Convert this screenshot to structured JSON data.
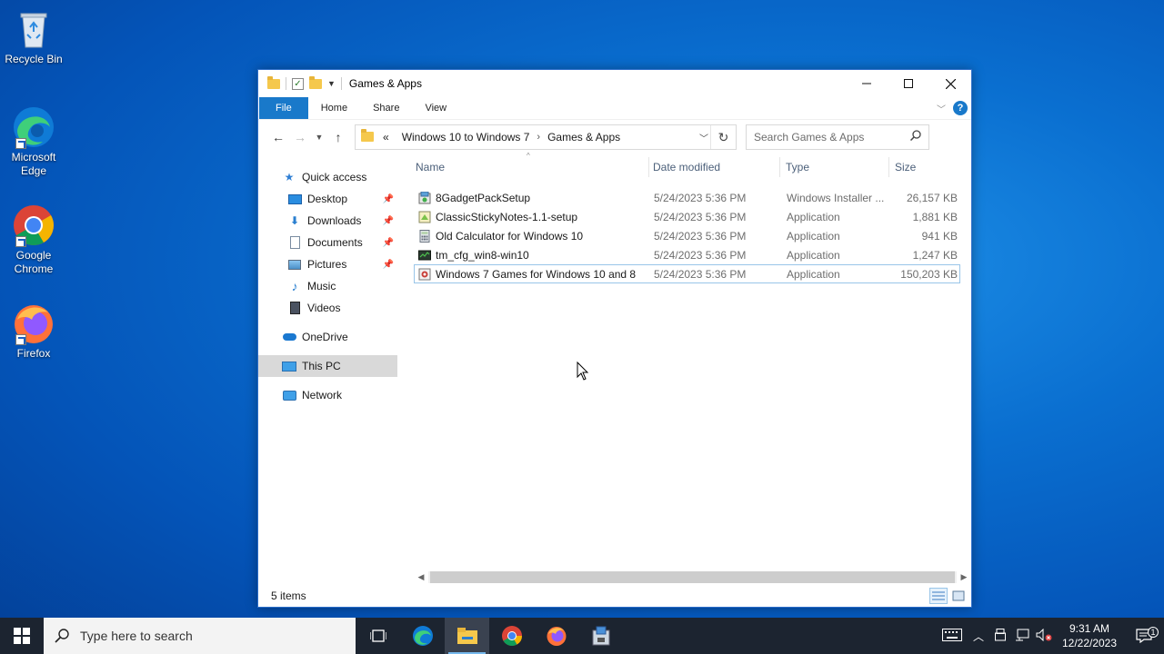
{
  "desktop": {
    "icons": [
      {
        "label": "Recycle Bin"
      },
      {
        "label": "Microsoft Edge"
      },
      {
        "label": "Google Chrome"
      },
      {
        "label": "Firefox"
      }
    ]
  },
  "window": {
    "title": "Games & Apps",
    "ribbon_tabs": {
      "file": "File",
      "home": "Home",
      "share": "Share",
      "view": "View"
    },
    "help_label": "?",
    "address": {
      "overflow": "«",
      "crumbs": [
        "Windows 10 to Windows 7",
        "Games & Apps"
      ]
    },
    "search_placeholder": "Search Games & Apps",
    "nav": {
      "quick_access": "Quick access",
      "desktop": "Desktop",
      "downloads": "Downloads",
      "documents": "Documents",
      "pictures": "Pictures",
      "music": "Music",
      "videos": "Videos",
      "onedrive": "OneDrive",
      "this_pc": "This PC",
      "network": "Network"
    },
    "columns": {
      "name": "Name",
      "date": "Date modified",
      "type": "Type",
      "size": "Size"
    },
    "files": [
      {
        "name": "8GadgetPackSetup",
        "date": "5/24/2023 5:36 PM",
        "type": "Windows Installer ...",
        "size": "26,157 KB"
      },
      {
        "name": "ClassicStickyNotes-1.1-setup",
        "date": "5/24/2023 5:36 PM",
        "type": "Application",
        "size": "1,881 KB"
      },
      {
        "name": "Old Calculator for Windows 10",
        "date": "5/24/2023 5:36 PM",
        "type": "Application",
        "size": "941 KB"
      },
      {
        "name": "tm_cfg_win8-win10",
        "date": "5/24/2023 5:36 PM",
        "type": "Application",
        "size": "1,247 KB"
      },
      {
        "name": "Windows 7 Games for Windows 10 and 8",
        "date": "5/24/2023 5:36 PM",
        "type": "Application",
        "size": "150,203 KB"
      }
    ],
    "status": "5 items"
  },
  "taskbar": {
    "search_placeholder": "Type here to search",
    "time": "9:31 AM",
    "date": "12/22/2023",
    "notification_count": "1"
  },
  "colors": {
    "accent": "#1979ca",
    "taskbar": "#1c2430",
    "selection_border": "#99c5e8"
  }
}
